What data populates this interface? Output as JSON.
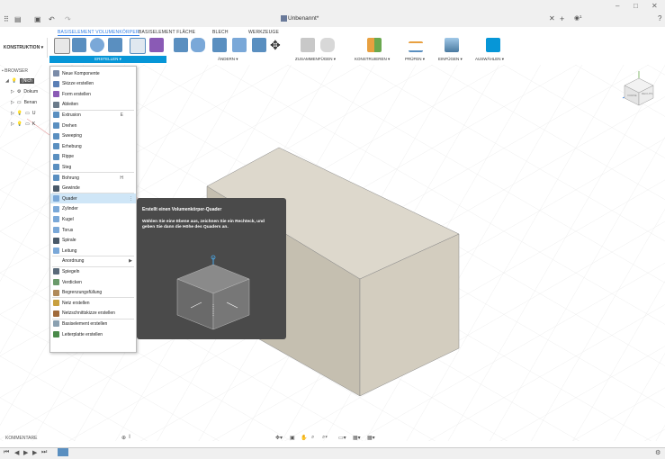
{
  "window": {
    "doc_title": "Unbenannt*",
    "controls": [
      "–",
      "□",
      "✕"
    ]
  },
  "tabs": [
    "BASISELEMENT VOLUMENKÖRPER",
    "BASISELEMENT FLÄCHE",
    "BLECH",
    "WERKZEUGE"
  ],
  "workspace_label": "KONSTRUKTION ▾",
  "groups": {
    "erstellen": "ERSTELLEN ▾",
    "aendern": "ÄNDERN ▾",
    "zusammenfuegen": "ZUSAMMENFÜGEN ▾",
    "konstruieren": "KONSTRUIEREN ▾",
    "pruefen": "PRÜFEN ▾",
    "einfuegen": "EINFÜGEN ▾",
    "auswaehlen": "AUSWÄHLEN ▾"
  },
  "browser": {
    "header": "BROWSER",
    "rows": [
      "(Nich",
      "Dokum",
      "Benan",
      "U",
      "K"
    ]
  },
  "menu": {
    "items": [
      {
        "label": "Neue Komponente",
        "icon": "component-icon",
        "color": "#7a8ba8"
      },
      {
        "label": "Skizze erstellen",
        "icon": "sketch-icon",
        "color": "#5a7fb5"
      },
      {
        "label": "Form erstellen",
        "icon": "form-icon",
        "color": "#8a5ab5"
      },
      {
        "label": "Ableiten",
        "icon": "derive-icon",
        "color": "#6a7a8a"
      },
      {
        "label": "Extrusion",
        "icon": "extrude-icon",
        "color": "#5a8fc0",
        "shortcut": "E"
      },
      {
        "label": "Drehen",
        "icon": "revolve-icon",
        "color": "#5a8fc0"
      },
      {
        "label": "Sweeping",
        "icon": "sweep-icon",
        "color": "#5a8fc0"
      },
      {
        "label": "Erhebung",
        "icon": "loft-icon",
        "color": "#5a8fc0"
      },
      {
        "label": "Rippe",
        "icon": "rib-icon",
        "color": "#5a8fc0"
      },
      {
        "label": "Steg",
        "icon": "web-icon",
        "color": "#5a8fc0"
      },
      {
        "label": "Bohrung",
        "icon": "hole-icon",
        "color": "#5a8fc0",
        "shortcut": "H"
      },
      {
        "label": "Gewinde",
        "icon": "thread-icon",
        "color": "#4a5a6a"
      },
      {
        "label": "Quader",
        "icon": "box-icon",
        "color": "#7aa8d8"
      },
      {
        "label": "Zylinder",
        "icon": "cylinder-icon",
        "color": "#7aa8d8"
      },
      {
        "label": "Kugel",
        "icon": "sphere-icon",
        "color": "#7aa8d8"
      },
      {
        "label": "Torus",
        "icon": "torus-icon",
        "color": "#7aa8d8"
      },
      {
        "label": "Spirale",
        "icon": "coil-icon",
        "color": "#4a5a6a"
      },
      {
        "label": "Leitung",
        "icon": "pipe-icon",
        "color": "#7aa8d8"
      },
      {
        "label": "Anordnung",
        "icon": "pattern-icon",
        "color": "#ffffff",
        "submenu": "▶"
      },
      {
        "label": "Spiegeln",
        "icon": "mirror-icon",
        "color": "#5a6a7a"
      },
      {
        "label": "Verdicken",
        "icon": "thicken-icon",
        "color": "#6a9a6a"
      },
      {
        "label": "Begrenzungsfüllung",
        "icon": "boundary-fill-icon",
        "color": "#b08a5a"
      },
      {
        "label": "Netz erstellen",
        "icon": "mesh-icon",
        "color": "#c8a040"
      },
      {
        "label": "Netzschnittskizze erstellen",
        "icon": "mesh-section-icon",
        "color": "#a06a3a"
      },
      {
        "label": "Basiselement erstellen",
        "icon": "base-feature-icon",
        "color": "#8aa0b0"
      },
      {
        "label": "Leiterplatte erstellen",
        "icon": "pcb-icon",
        "color": "#4a8a4a"
      }
    ]
  },
  "tooltip": {
    "title": "Erstellt einen Volumenkörper-Quader",
    "description": "Wählen Sie eine Ebene aus, zeichnen Sie ein Rechteck, und geben Sie dann die Höhe des Quaders an."
  },
  "comments_label": "KOMMENTARE",
  "viewcube": {
    "front": "VORNE",
    "right": "RECHTS"
  }
}
